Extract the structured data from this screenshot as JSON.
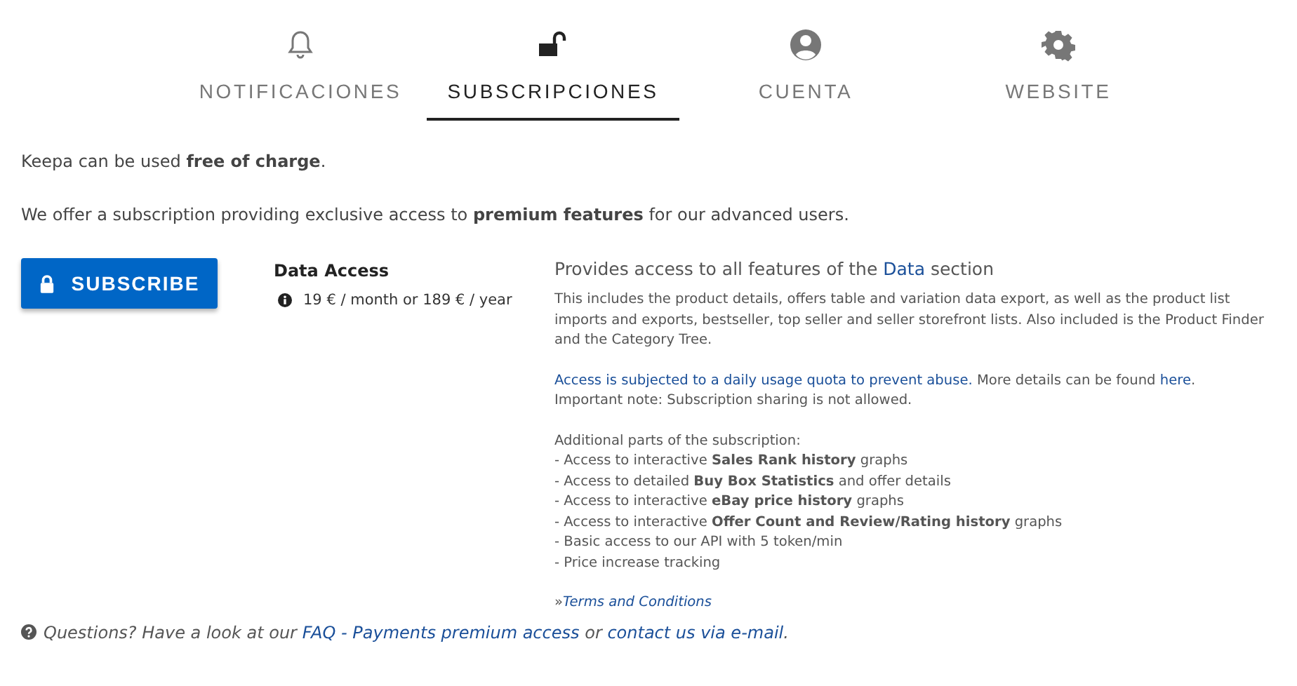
{
  "tabs": [
    {
      "label": "NOTIFICACIONES",
      "kind": "bell",
      "selected": false
    },
    {
      "label": "SUBSCRIPCIONES",
      "kind": "lock",
      "selected": true
    },
    {
      "label": "CUENTA",
      "kind": "user",
      "selected": false
    },
    {
      "label": "WEBSITE",
      "kind": "gear",
      "selected": false
    }
  ],
  "intro": [
    "Keepa can be used **free of charge**.",
    "We offer a subscription providing exclusive access to **premium features** for our advanced users."
  ],
  "subscribe_button": "SUBSCRIBE",
  "plan": {
    "name": "Data Access",
    "price": "19 € / month or 189 € / year"
  },
  "details": {
    "heading": [
      {
        "kind": "text",
        "text": "Provides access to all features of the "
      },
      {
        "kind": "link",
        "text": "Data"
      },
      {
        "kind": "text",
        "text": " section"
      }
    ],
    "description": "This includes the product details, offers table and variation data export, as well as the product list imports and exports, bestseller, top seller and seller storefront lists. Also included is the Product Finder and the Category Tree.",
    "quota": [
      {
        "kind": "link",
        "text": "Access is subjected to a daily usage quota to prevent abuse."
      },
      {
        "kind": "text",
        "text": " More details can be found "
      },
      {
        "kind": "link",
        "text": "here"
      },
      {
        "kind": "text",
        "text": "."
      }
    ],
    "note": "Important note: Subscription sharing is not allowed.",
    "parts_title": "Additional parts of the subscription:",
    "parts": [
      "- Access to interactive **Sales Rank history** graphs",
      "- Access to detailed **Buy Box Statistics** and offer details",
      "- Access to interactive **eBay price history** graphs",
      "- Access to interactive **Offer Count and Review/Rating history** graphs",
      "- Basic access to our API with 5 token/min",
      "- Price increase tracking"
    ],
    "terms": [
      {
        "kind": "text",
        "text": "»"
      },
      {
        "kind": "link",
        "text": "Terms and Conditions"
      }
    ]
  },
  "footer": [
    {
      "kind": "text",
      "text": "Questions? Have a look at our "
    },
    {
      "kind": "link",
      "text": "FAQ - Payments premium access"
    },
    {
      "kind": "text",
      "text": " or "
    },
    {
      "kind": "link",
      "text": "contact us via e-mail"
    },
    {
      "kind": "text",
      "text": "."
    }
  ]
}
